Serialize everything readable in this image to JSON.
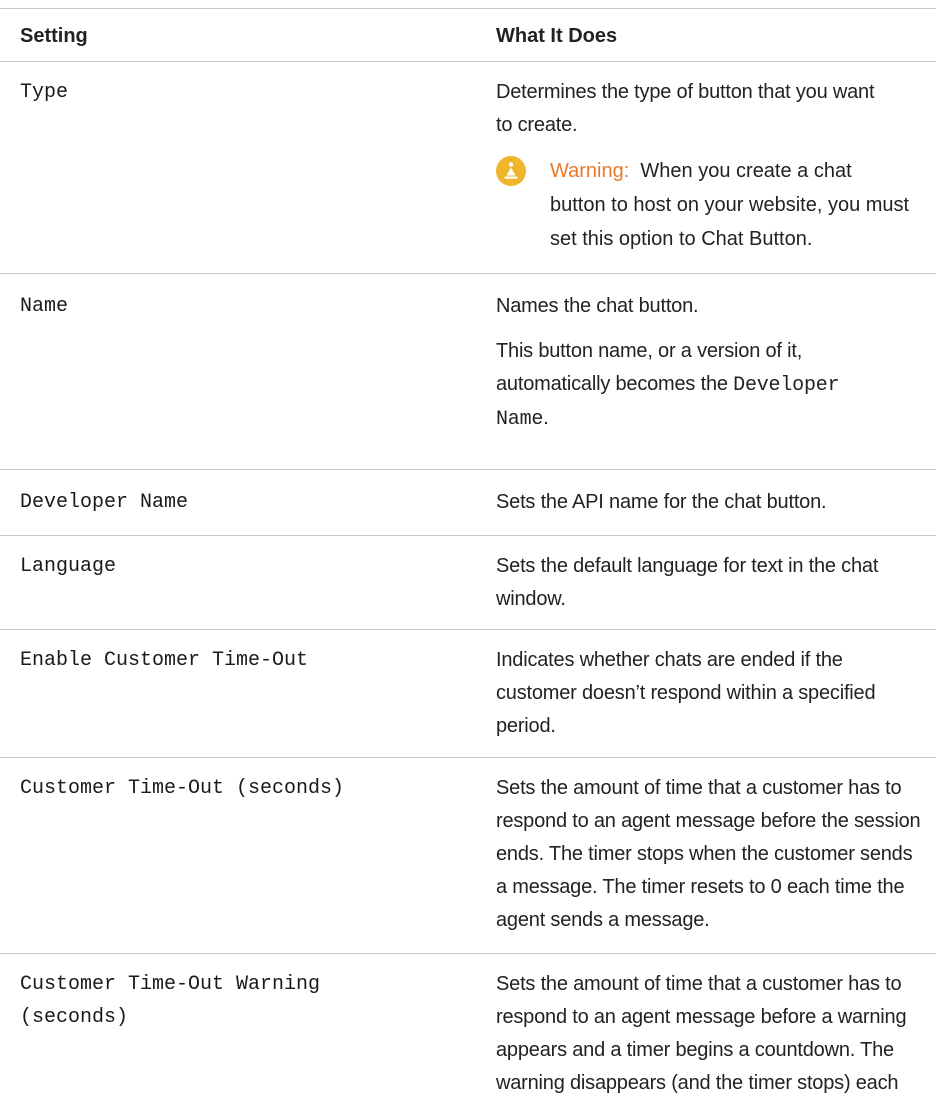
{
  "table": {
    "header": {
      "setting": "Setting",
      "what_it_does": "What It Does"
    },
    "rows": [
      {
        "setting": "Type",
        "desc": [
          "Determines the type of button that you want",
          "to create."
        ],
        "warning": {
          "label": "Warning:",
          "lines": [
            "When you create a chat",
            "button to host on your website, you must",
            "set this option to Chat Button."
          ]
        }
      },
      {
        "setting": "Name",
        "desc": [
          "Names the chat button."
        ],
        "desc2": [
          "This button name, or a version of it,",
          "automatically becomes the"
        ],
        "desc2_mono_a": "Developer",
        "desc2_mono_b": "Name",
        "desc2_end": "."
      },
      {
        "setting": "Developer Name",
        "desc": [
          "Sets the API name for the chat button."
        ]
      },
      {
        "setting": "Language",
        "desc": [
          "Sets the default language for text in the chat",
          "window."
        ]
      },
      {
        "setting": "Enable Customer Time-Out",
        "desc": [
          "Indicates whether chats are ended if the",
          "customer doesn’t respond within a specified",
          "period."
        ]
      },
      {
        "setting": "Customer Time-Out (seconds)",
        "desc": [
          "Sets the amount of time that a customer has to",
          "respond to an agent message before the session",
          "ends. The timer stops when the customer sends",
          "a message. The timer resets to 0 each time the",
          "agent sends a message."
        ]
      },
      {
        "setting_lines": [
          "Customer Time-Out Warning",
          "(seconds)"
        ],
        "desc": [
          "Sets the amount of time that a customer has to",
          "respond to an agent message before a warning",
          "appears and a timer begins a countdown. The",
          "warning disappears (and the timer stops) each"
        ]
      }
    ]
  }
}
